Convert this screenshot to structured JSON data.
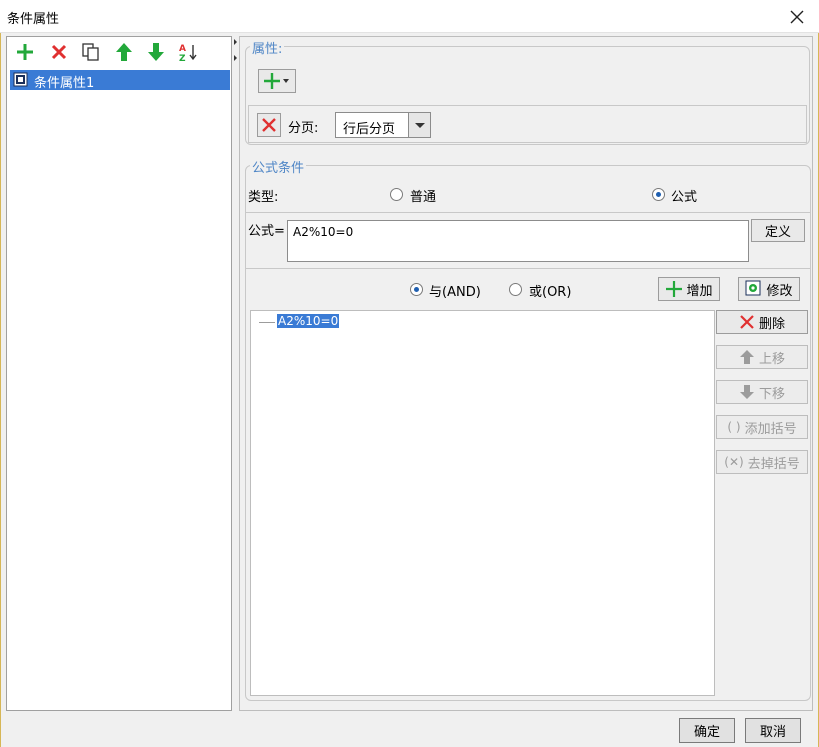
{
  "window": {
    "title": "条件属性"
  },
  "toolbar": {
    "icons": [
      "add-icon",
      "delete-icon",
      "copy-icon",
      "move-up-icon",
      "move-down-icon",
      "sort-icon"
    ]
  },
  "tree": {
    "items": [
      {
        "label": "条件属性1"
      }
    ]
  },
  "properties": {
    "legend": "属性:",
    "page_break_label": "分页:",
    "page_break_value": "行后分页"
  },
  "formula_condition": {
    "legend": "公式条件",
    "type_label": "类型:",
    "type_normal": "普通",
    "type_formula": "公式",
    "selected_type": "公式",
    "formula_label": "公式=",
    "formula_value": "A2%10=0",
    "define_button": "定义",
    "and_label": "与(AND)",
    "or_label": "或(OR)",
    "selected_logic": "AND",
    "add_button": "增加",
    "modify_button": "修改",
    "conditions": [
      "A2%10=0"
    ],
    "delete_button": "删除",
    "move_up_button": "上移",
    "move_down_button": "下移",
    "add_bracket_button": "添加括号",
    "remove_bracket_button": "去掉括号"
  },
  "footer": {
    "ok": "确定",
    "cancel": "取消"
  },
  "colors": {
    "accent": "#3a7bd5",
    "green": "#22a83a",
    "red": "#e03030",
    "legend": "#4f86c6"
  }
}
